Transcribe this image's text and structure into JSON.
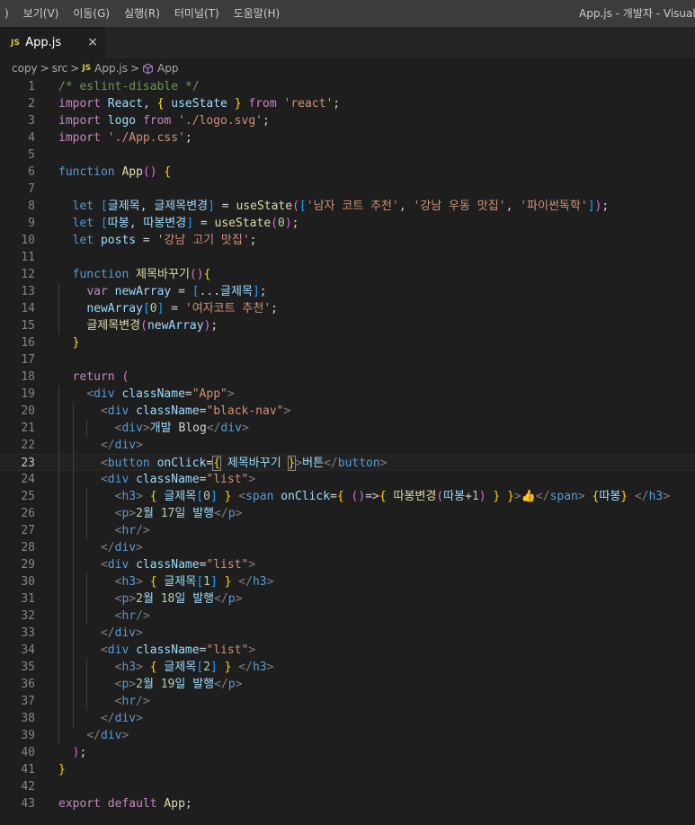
{
  "titlebar": {
    "menu": ")",
    "menu_items": [
      "보기(V)",
      "이동(G)",
      "실행(R)",
      "터미널(T)",
      "도움말(H)"
    ],
    "window_title": "App.js - 개발자 - Visual S"
  },
  "tab": {
    "badge": "JS",
    "filename": "App.js",
    "close": "×"
  },
  "breadcrumb": {
    "items": [
      "copy",
      "src",
      "App.js",
      "App"
    ],
    "js_badge": "JS",
    "separator": ">"
  },
  "editor": {
    "active_line": 23,
    "lines": [
      "/* eslint-disable */",
      "import React, { useState } from 'react';",
      "import logo from './logo.svg';",
      "import './App.css';",
      "",
      "function App() {",
      "",
      "  let [글제목, 글제목변경] = useState(['남자 코트 추천', '강남 우동 맛집', '파이썬독학']);",
      "  let [따봉, 따봉변경] = useState(0);",
      "  let posts = '강남 고기 맛집';",
      "",
      "  function 제목바꾸기(){",
      "    var newArray = [...글제목];",
      "    newArray[0] = '여자코트 추천';",
      "    글제목변경(newArray);",
      "  }",
      "",
      "  return (",
      "    <div className=\"App\">",
      "      <div className=\"black-nav\">",
      "        <div>개발 Blog</div>",
      "      </div>",
      "      <button onClick={ 제목바꾸기 }>버튼</button>",
      "      <div className=\"list\">",
      "        <h3> { 글제목[0] } <span onClick={ ()=>{ 따봉변경(따봉+1) } }>👍</span> {따봉} </h3>",
      "        <p>2월 17일 발행</p>",
      "        <hr/>",
      "      </div>",
      "      <div className=\"list\">",
      "        <h3> { 글제목[1] } </h3>",
      "        <p>2월 18일 발행</p>",
      "        <hr/>",
      "      </div>",
      "      <div className=\"list\">",
      "        <h3> { 글제목[2] } </h3>",
      "        <p>2월 19일 발행</p>",
      "        <hr/>",
      "      </div>",
      "    </div>",
      "  );",
      "}",
      "",
      "export default App;"
    ]
  },
  "colors": {
    "background": "#1e1e1e",
    "titlebar": "#3c3c3c",
    "tabbar": "#252526",
    "comment": "#6a9955",
    "keyword": "#c586c0",
    "declaration": "#569cd6",
    "variable": "#9cdcfe",
    "function": "#dcdcaa",
    "string": "#ce9178",
    "number": "#b5cea8"
  },
  "icons": {
    "tab_file": "javascript-file-icon",
    "breadcrumb_symbol": "cube-icon"
  }
}
